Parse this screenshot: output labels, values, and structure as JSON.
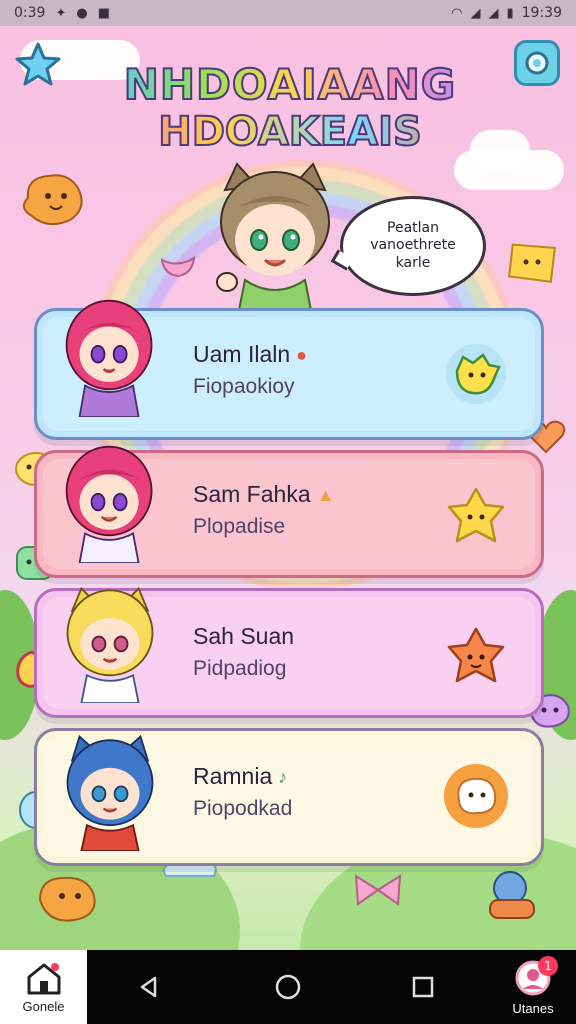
{
  "status_bar": {
    "time_left": "0:39",
    "time_right": "19:39",
    "icons": [
      "puzzle-icon",
      "shield-icon",
      "bag-icon",
      "wifi-icon",
      "signal-icon",
      "signal-icon",
      "battery-icon"
    ]
  },
  "header": {
    "title_line1": "NHDOAIAANG",
    "title_line2": "HDOAKEAIS"
  },
  "host": {
    "speech": "Peatlan vanoethrete karle"
  },
  "cards": [
    {
      "name": "Uam Ilaln",
      "subtitle": "Fiopaokioy",
      "accent": "#bfe6fb",
      "border": "#6a8fc8",
      "badge": "yellow-blob-icon"
    },
    {
      "name": "Sam Fahka",
      "subtitle": "Plopadise",
      "accent": "#f9b7c2",
      "border": "#c96a86",
      "badge": "yellow-star-icon"
    },
    {
      "name": "Sah Suan",
      "subtitle": "Pidpadiog",
      "accent": "#f7c4ee",
      "border": "#b16fc0",
      "badge": "orange-star-icon"
    },
    {
      "name": "Ramnia",
      "subtitle": "Piopodkad",
      "accent": "#fbf5d9",
      "border": "#8a7fa0",
      "badge": "white-ghost-icon"
    }
  ],
  "nav": {
    "home_label": "Gonele",
    "profile_label": "Utanes",
    "notification_count": "1"
  },
  "colors": {
    "status_bar": "#c9b7c4",
    "nav_bar": "#050505",
    "accent_pink": "#f9bfe0"
  }
}
